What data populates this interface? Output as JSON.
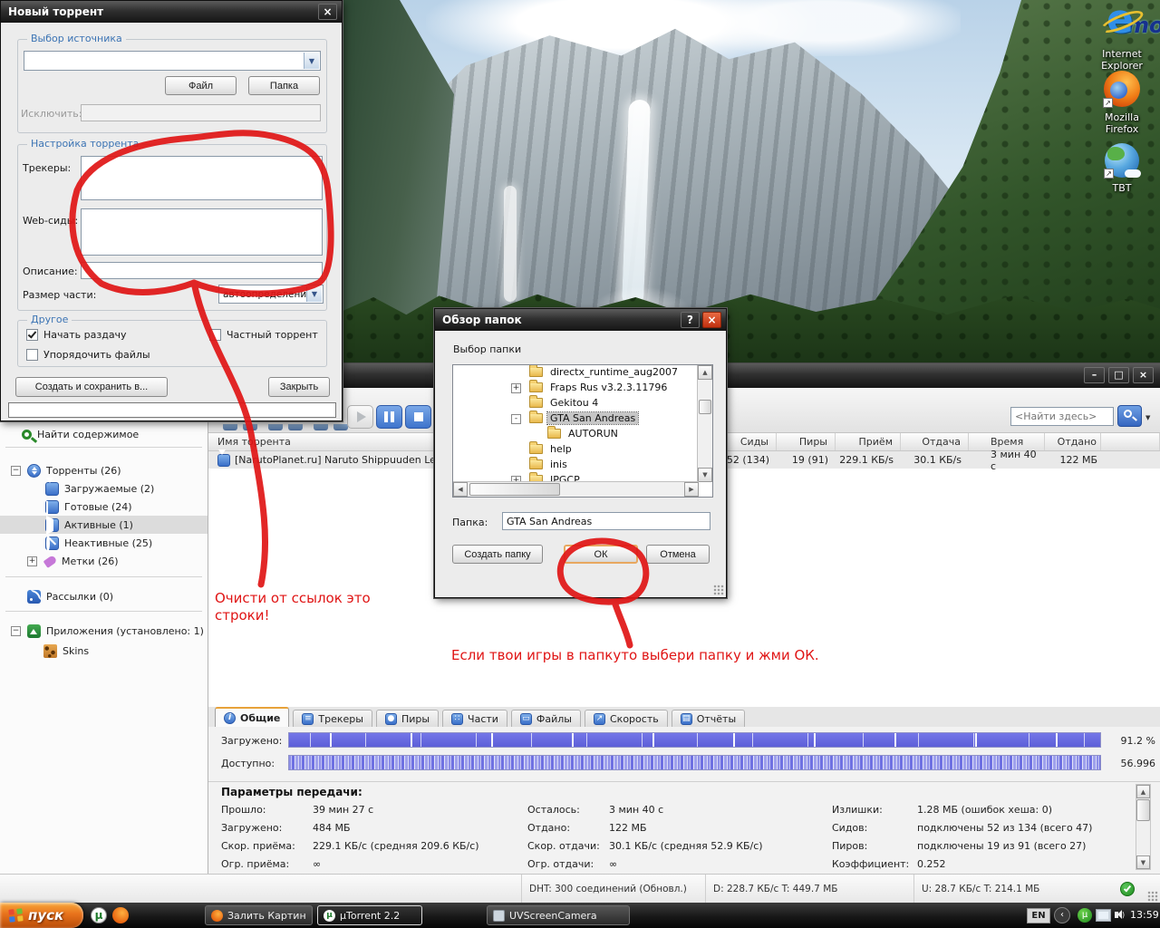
{
  "desktop": {
    "watermark": "mo",
    "icons": [
      {
        "label": "Internet Explorer"
      },
      {
        "label": "Mozilla Firefox"
      },
      {
        "label": "TBT"
      }
    ]
  },
  "new_torrent": {
    "title": "Новый торрент",
    "source": {
      "group_label": "Выбор источника",
      "file_btn": "Файл",
      "folder_btn": "Папка",
      "exclude_label": "Исключить:"
    },
    "settings": {
      "group_label": "Настройка торрента",
      "trackers_label": "Трекеры:",
      "webseeds_label": "Web-сиды:",
      "description_label": "Описание:",
      "piece_label": "Размер части:",
      "piece_value": "автоопределение"
    },
    "other": {
      "group_label": "Другое",
      "start_seed": "Начать раздачу",
      "private": "Частный торрент",
      "order": "Упорядочить файлы"
    },
    "create_btn": "Создать и сохранить в...",
    "close_btn": "Закрыть"
  },
  "browse": {
    "title": "Обзор папок",
    "subtitle": "Выбор папки",
    "tree": [
      {
        "name": "directx_runtime_aug2007",
        "expander": ""
      },
      {
        "name": "Fraps Rus v3.2.3.11796",
        "expander": "+"
      },
      {
        "name": "Gekitou 4",
        "expander": ""
      },
      {
        "name": "GTA San Andreas",
        "expander": "-"
      },
      {
        "name": "AUTORUN",
        "expander": ""
      },
      {
        "name": "help",
        "expander": ""
      },
      {
        "name": "inis",
        "expander": ""
      },
      {
        "name": "JPGCP",
        "expander": "+"
      }
    ],
    "folder_label": "Папка:",
    "folder_value": "GTA San Andreas",
    "new_folder_btn": "Создать папку",
    "ok_btn": "ОК",
    "cancel_btn": "Отмена"
  },
  "main": {
    "search_placeholder": "<Найти здесь>",
    "sidebar": {
      "find": "Найти содержимое",
      "torrents": "Торренты (26)",
      "downloading": "Загружаемые (2)",
      "finished": "Готовые (24)",
      "active": "Активные (1)",
      "inactive": "Неактивные (25)",
      "labels": "Метки (26)",
      "feeds": "Рассылки (0)",
      "apps": "Приложения (установлено: 1)",
      "skins": "Skins"
    },
    "columns": [
      "Имя торрента",
      "Сиды",
      "Пиры",
      "Приём",
      "Отдача",
      "Время",
      "Отдано"
    ],
    "row": {
      "name": "[NarutoPlanet.ru] Naruto Shippuuden Legends",
      "seeds": "52 (134)",
      "peers": "19 (91)",
      "down": "229.1 КБ/s",
      "up": "30.1 КБ/s",
      "eta": "3 мин 40 с",
      "uploaded": "122 МБ"
    },
    "tabs": [
      "Общие",
      "Трекеры",
      "Пиры",
      "Части",
      "Файлы",
      "Скорость",
      "Отчёты"
    ],
    "general": {
      "downloaded_label": "Загружено:",
      "downloaded_value": "91.2 %",
      "available_label": "Доступно:",
      "available_value": "56.996",
      "heading": "Параметры передачи:",
      "col1": [
        {
          "label": "Прошло:",
          "value": "39 мин 27 с"
        },
        {
          "label": "Загружено:",
          "value": "484 МБ"
        },
        {
          "label": "Скор. приёма:",
          "value": "229.1 КБ/с (средняя 209.6 КБ/с)"
        },
        {
          "label": "Огр. приёма:",
          "value": "∞"
        }
      ],
      "col2": [
        {
          "label": "Осталось:",
          "value": "3 мин 40 с"
        },
        {
          "label": "Отдано:",
          "value": "122 МБ"
        },
        {
          "label": "Скор. отдачи:",
          "value": "30.1 КБ/с (средняя 52.9 КБ/с)"
        },
        {
          "label": "Огр. отдачи:",
          "value": "∞"
        }
      ],
      "col3": [
        {
          "label": "Излишки:",
          "value": "1.28 МБ (ошибок хеша: 0)"
        },
        {
          "label": "Сидов:",
          "value": "подключены 52 из 134 (всего 47)"
        },
        {
          "label": "Пиров:",
          "value": "подключены 19 из 91 (всего 27)"
        },
        {
          "label": "Коэффициент:",
          "value": "0.252"
        }
      ]
    },
    "status": {
      "dht": "DHT: 300 соединений (Обновл.)",
      "down": "D: 228.7 КБ/с T: 449.7 МБ",
      "up": "U: 28.7 КБ/с T: 214.1 МБ"
    }
  },
  "annotations": {
    "note1": "Очисти от ссылок это строки!",
    "note2": "Если твои игры в папкуто выбери папку и жми ОК."
  },
  "taskbar": {
    "start": "пуск",
    "tasks": [
      {
        "label": "Залить Картинку - З..."
      },
      {
        "label": "µTorrent 2.2"
      },
      {
        "label": "UVScreenCamera"
      }
    ],
    "tray": {
      "lang": "EN",
      "time": "13:59"
    }
  },
  "colors": {
    "accent_blue": "#3a70c8",
    "annotation_red": "#e01515",
    "bar_blue": "#6466e0",
    "start_orange": "#e8731c"
  }
}
